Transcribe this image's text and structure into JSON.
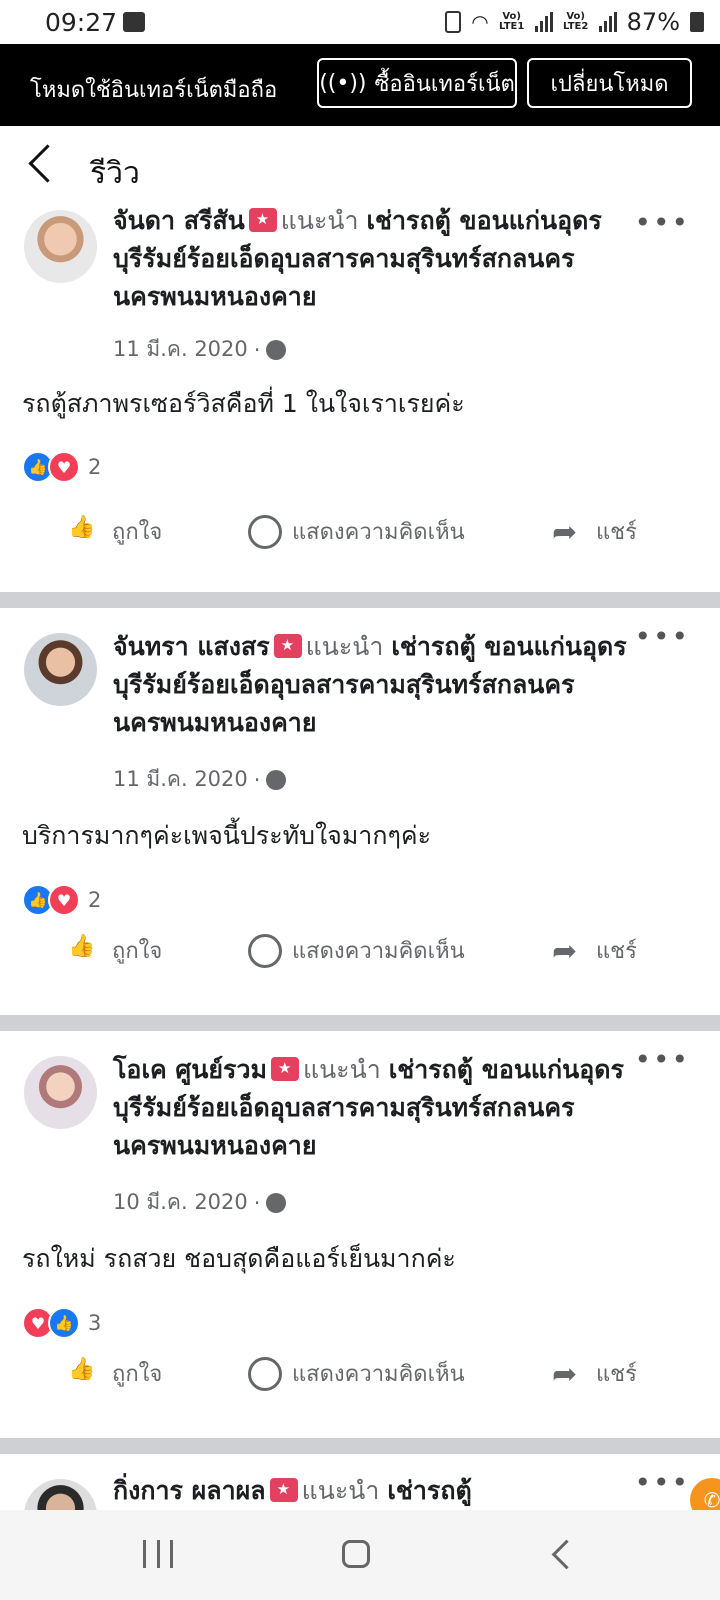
{
  "status_bar": {
    "time": "09:27",
    "lte1": "Vo) LTE1",
    "lte2": "Vo) LTE2",
    "battery": "87%"
  },
  "mode_bar": {
    "label": "โหมดใช้อินเทอร์เน็ตมือถือ",
    "buy_button": "ซื้ออินเทอร์เน็ต",
    "switch_button": "เปลี่ยนโหมด"
  },
  "header": {
    "title": "รีวิว"
  },
  "posts": [
    {
      "author": "จันดา สรีสัน",
      "recommends": "แนะนำ",
      "page": "เช่ารถตู้ ขอนแก่นอุดรบุรีรัมย์ร้อยเอ็ดอุบลสารคามสุรินทร์สกลนครนครพนมหนองคาย",
      "date": "11 มี.ค. 2020",
      "sep": "·",
      "text": "รถตู้สภาพรเซอร์วิสคือที่ 1 ในใจเราเรยค่ะ",
      "reaction_count": "2",
      "reactions_order": [
        "like",
        "love"
      ]
    },
    {
      "author": "จันทรา แสงสร",
      "recommends": "แนะนำ",
      "page": "เช่ารถตู้ ขอนแก่นอุดรบุรีรัมย์ร้อยเอ็ดอุบลสารคามสุรินทร์สกลนครนครพนมหนองคาย",
      "date": "11 มี.ค. 2020",
      "sep": "·",
      "text": "บริการมากๆค่ะเพจนี้ประทับใจมากๆค่ะ",
      "reaction_count": "2",
      "reactions_order": [
        "like",
        "love"
      ]
    },
    {
      "author": "โอเค ศูนย์รวม",
      "recommends": "แนะนำ",
      "page": "เช่ารถตู้ ขอนแก่นอุดรบุรีรัมย์ร้อยเอ็ดอุบลสารคามสุรินทร์สกลนครนครพนมหนองคาย",
      "date": "10 มี.ค. 2020",
      "sep": "·",
      "text": "รถใหม่ รถสวย ชอบสุดคือแอร์เย็นมากค่ะ",
      "reaction_count": "3",
      "reactions_order": [
        "love",
        "like"
      ]
    },
    {
      "author": "กิ่งการ ผลาผล",
      "recommends": "แนะนำ",
      "page": "เช่ารถตู้"
    }
  ],
  "actions": {
    "like": "ถูกใจ",
    "comment": "แสดงความคิดเห็น",
    "share": "แชร์"
  },
  "more_glyph": "•••",
  "colors": {
    "like_blue": "#1877f2",
    "love_red": "#f33e58",
    "badge": "#e4405f",
    "divider": "#ced0d4",
    "fab": "#f7941d"
  }
}
